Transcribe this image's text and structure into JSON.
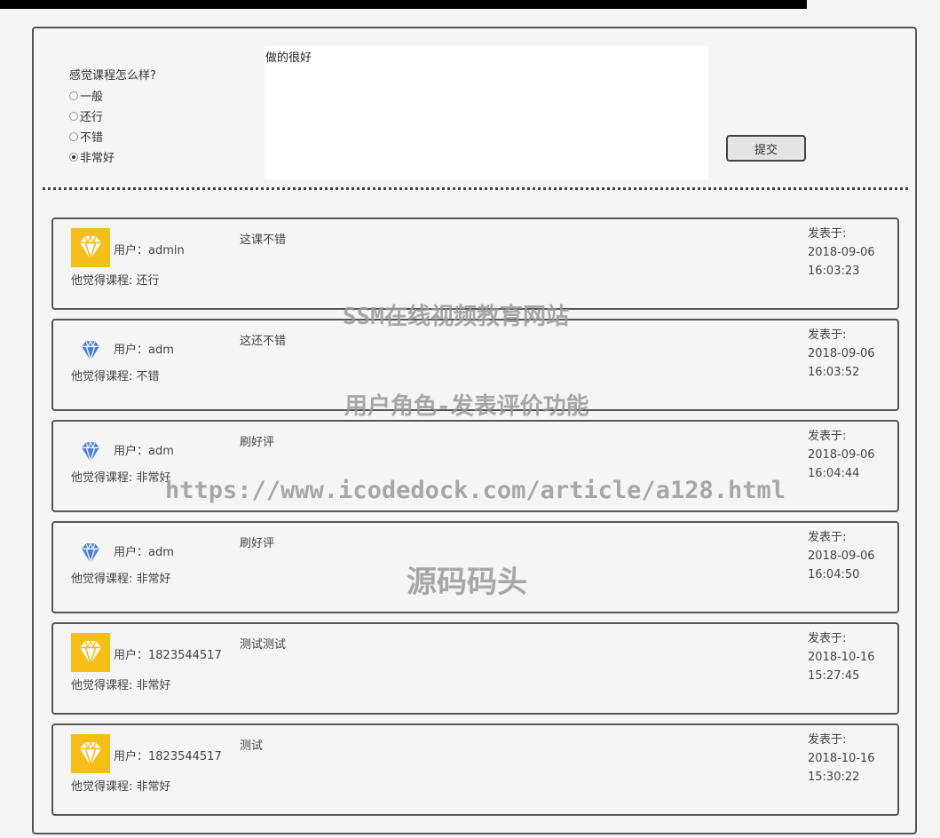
{
  "form": {
    "question": "感觉课程怎么样?",
    "options": [
      "一般",
      "还行",
      "不错",
      "非常好"
    ],
    "selected_index": 3,
    "comment_value": "做的很好",
    "submit_label": "提交"
  },
  "comments": [
    {
      "user_label": "用户：admin",
      "rating_label": "他觉得课程: 还行",
      "content": "这课不错",
      "posted_label": "发表于:",
      "date": "2018-09-06",
      "time": "16:03:23",
      "avatar": "gold-diamond-icon"
    },
    {
      "user_label": "用户：adm",
      "rating_label": "他觉得课程: 不错",
      "content": "这还不错",
      "posted_label": "发表于:",
      "date": "2018-09-06",
      "time": "16:03:52",
      "avatar": "blue-diamond-icon"
    },
    {
      "user_label": "用户：adm",
      "rating_label": "他觉得课程: 非常好",
      "content": "刷好评",
      "posted_label": "发表于:",
      "date": "2018-09-06",
      "time": "16:04:44",
      "avatar": "blue-diamond-icon"
    },
    {
      "user_label": "用户：adm",
      "rating_label": "他觉得课程: 非常好",
      "content": "刷好评",
      "posted_label": "发表于:",
      "date": "2018-09-06",
      "time": "16:04:50",
      "avatar": "blue-diamond-icon"
    },
    {
      "user_label": "用户：1823544517",
      "rating_label": "他觉得课程: 非常好",
      "content": "测试测试",
      "posted_label": "发表于:",
      "date": "2018-10-16",
      "time": "15:27:45",
      "avatar": "gold-diamond-icon"
    },
    {
      "user_label": "用户：1823544517",
      "rating_label": "他觉得课程: 非常好",
      "content": "测试",
      "posted_label": "发表于:",
      "date": "2018-10-16",
      "time": "15:30:22",
      "avatar": "gold-diamond-icon"
    }
  ],
  "watermarks": [
    "SSM在线视频教育网站",
    "用户角色-发表评价功能",
    "https://www.icodedock.com/article/a128.html",
    "源码码头"
  ],
  "colors": {
    "gold": "#f5be18",
    "blue": "#4a7fd9"
  }
}
